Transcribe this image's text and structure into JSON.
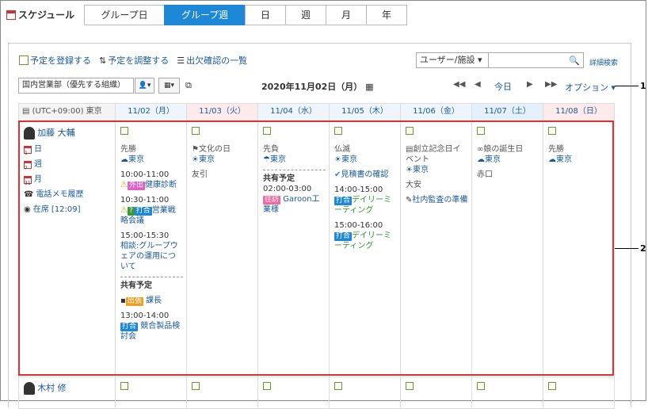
{
  "app": {
    "title": "スケジュール"
  },
  "tabs": [
    "グループ日",
    "グループ週",
    "日",
    "週",
    "月",
    "年"
  ],
  "active_tab": 1,
  "actions": {
    "register": "予定を登録する",
    "adjust": "予定を調整する",
    "attendance": "出欠確認の一覧"
  },
  "search": {
    "target": "ユーザー/施設",
    "advanced": "詳細検索"
  },
  "group_select": "国内営業部（優先する組織）",
  "date_heading": "2020年11月02日（月）",
  "nav": {
    "prev_week": "◀◀",
    "prev_day": "◀",
    "today": "今日",
    "next_day": "▶",
    "next_week": "▶▶",
    "option": "オプション"
  },
  "timezone": "(UTC+09:00) 東京",
  "days": [
    "11/02（月）",
    "11/03（火）",
    "11/04（水）",
    "11/05（木）",
    "11/06（金）",
    "11/07（土）",
    "11/08（日）"
  ],
  "user1": {
    "name": "加藤 大輔",
    "menu": [
      "日",
      "週",
      "月",
      "電話メモ履歴",
      "在席 [12:09]"
    ],
    "menu_icons": [
      "1",
      "7",
      "31"
    ]
  },
  "mon": {
    "rokuyo": "先勝",
    "weather": "東京",
    "ev1_time": "10:00-11:00",
    "ev1_tag": "外出",
    "ev1_title": "健康診断",
    "ev2_time": "10:30-11:00",
    "ev2_tag": "打合",
    "ev2_title": "営業戦略会議",
    "ev2_q": "?",
    "ev3_time": "15:00-15:30",
    "ev3_title": "相談:グループウェアの運用について",
    "shared_label": "共有予定",
    "sev1_tag": "出張",
    "sev1_title": "課長",
    "sev2_time": "13:00-14:00",
    "sev2_tag": "打合",
    "sev2_title": "競合製品検討会"
  },
  "tue": {
    "holiday": "文化の日",
    "weather": "東京",
    "rokuyo": "友引"
  },
  "wed": {
    "rokuyo": "先負",
    "weather": "東京",
    "shared_label": "共有予定",
    "sev_time": "02:00-03:00",
    "sev_tag": "往訪",
    "sev_title": "Garoon工業様"
  },
  "thu": {
    "rokuyo": "仏滅",
    "weather": "東京",
    "todo": "見積書の確認",
    "ev1_time": "14:00-15:00",
    "ev1_tag": "打合",
    "ev1_title": "デイリーミーティング",
    "ev2_time": "15:00-16:00",
    "ev2_tag": "打合",
    "ev2_title": "デイリーミーティング"
  },
  "fri": {
    "anniv": "創立記念日イベント",
    "weather": "東京",
    "rokuyo": "大安",
    "todo": "社内監査の準備"
  },
  "sat": {
    "anniv": "娘の誕生日",
    "weather": "東京",
    "rokuyo": "赤口"
  },
  "sun": {
    "rokuyo": "先勝",
    "weather": "東京"
  },
  "user2": {
    "name": "木村 修"
  },
  "callouts": [
    "1",
    "2"
  ],
  "colors": {
    "accent": "#1e88d8",
    "highlight": "#e03030",
    "link": "#1a5a9a"
  }
}
